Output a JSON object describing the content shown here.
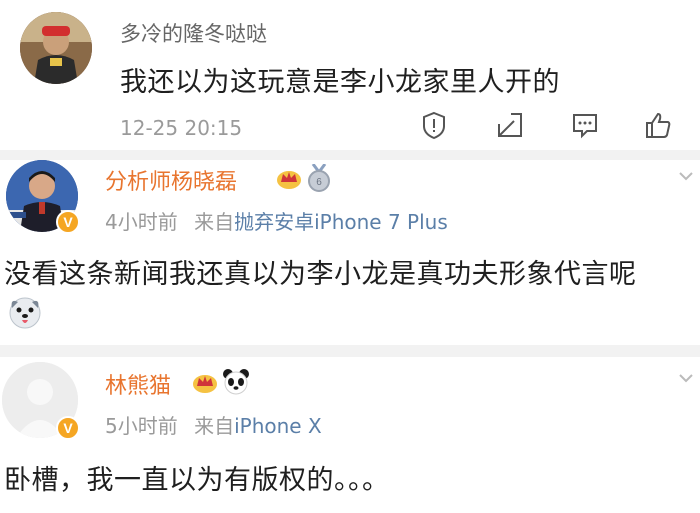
{
  "top_post": {
    "username": "多冷的隆冬哒哒",
    "text": "我还以为这玩意是李小龙家里人开的",
    "timestamp": "12-25 20:15",
    "actions": [
      "report-icon",
      "repost-icon",
      "comment-icon",
      "like-icon"
    ]
  },
  "comments": [
    {
      "username": "分析师杨晓磊",
      "time": "4小时前",
      "source_prefix": "来自",
      "source_device": "抛弃安卓iPhone 7 Plus",
      "text": "没看这条新闻我还真以为李小龙是真功夫形象代言呢",
      "emoji": "dog-face-icon",
      "badges": [
        "crown-icon",
        "medal-icon"
      ]
    },
    {
      "username": "林熊猫",
      "time": "5小时前",
      "source_prefix": "来自",
      "source_device": "iPhone X",
      "text": "卧槽，我一直以为有版权的。。。",
      "badges": [
        "crown-icon",
        "panda-icon"
      ]
    }
  ],
  "colors": {
    "username_orange": "#e8752f",
    "meta_gray": "#9a9a9a",
    "link_blue": "#5b7fa8",
    "divider": "#f2f2f2",
    "verified_badge": "#f5a623"
  }
}
